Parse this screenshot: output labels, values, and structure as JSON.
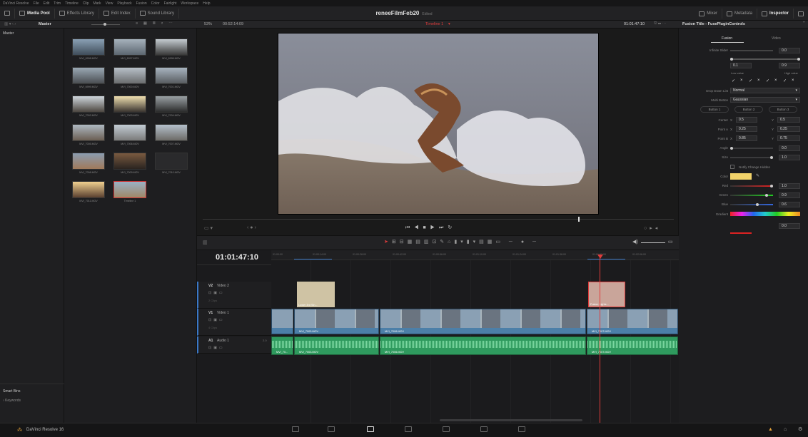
{
  "menu": [
    "DaVinci Resolve",
    "File",
    "Edit",
    "Trim",
    "Timeline",
    "Clip",
    "Mark",
    "View",
    "Playback",
    "Fusion",
    "Color",
    "Fairlight",
    "Workspace",
    "Help"
  ],
  "toolbar": {
    "media_pool": "Media Pool",
    "effects_library": "Effects Library",
    "edit_index": "Edit Index",
    "sound_library": "Sound Library",
    "mixer": "Mixer",
    "metadata": "Metadata",
    "inspector": "Inspector"
  },
  "project": {
    "title": "reneeFilmFeb20",
    "status": "Edited"
  },
  "viewerbar": {
    "bin": "Master",
    "zoom": "53%",
    "source_tc": "00:52:14:09",
    "timeline_name": "Timeline 1",
    "record_tc": "01:01:47:10"
  },
  "inspector": {
    "title": "Fusion Title - FusePluginControls",
    "tab_fusion": "Fusion",
    "tab_video": "Video"
  },
  "bins": {
    "master": "Master",
    "smart_bins": "Smart Bins",
    "keywords": "Keywords"
  },
  "clips": [
    "MVI_6998.MOV",
    "MVI_6997.MOV",
    "MVI_6996.MOV",
    "MVI_6999.MOV",
    "MVI_7000.MOV",
    "MVI_7001.MOV",
    "MVI_7002.MOV",
    "MVI_7003.MOV",
    "MVI_7004.MOV",
    "MVI_7005.MOV",
    "MVI_7006.MOV",
    "MVI_7007.MOV",
    "MVI_7008.MOV",
    "MVI_7009.MOV",
    "MVI_7010.MOV",
    "MVI_7011.MOV",
    "Timeline 1"
  ],
  "controls": {
    "infinite_slider": "Infinite Slider",
    "infinite_val": "0.0",
    "low_val": "0.1",
    "high_val": "0.9",
    "low_label": "Low value",
    "high_label": "High value",
    "drop_down": "Drop Down List",
    "drop_val": "Normal",
    "multi_button": "Multi Button",
    "multi_val": "Gaussian",
    "btn1": "Button 1",
    "btn2": "Button 2",
    "btn3": "Button 3",
    "center": "Center",
    "center_x": "0.5",
    "center_y": "0.5",
    "point_a": "Point A",
    "pa_x": "0.25",
    "pa_y": "0.25",
    "point_b": "Point B",
    "pb_x": "0.85",
    "pb_y": "0.75",
    "angle": "Angle",
    "angle_val": "0.0",
    "size": "Size",
    "size_val": "1.0",
    "notify": "Notify Change Hidden",
    "color": "Color",
    "red": "Red",
    "red_val": "1.0",
    "green": "Green",
    "green_val": "0.9",
    "blue": "Blue",
    "blue_val": "0.6",
    "gradient": "Gradient",
    "grad_val": "0.0",
    "x": "X",
    "y": "Y"
  },
  "timeline": {
    "timecode": "01:01:47:10",
    "ruler": [
      "01:00:00",
      "01:00:14:00",
      "01:00:28:00",
      "01:00:42:00",
      "01:00:56:00",
      "01:01:10:00",
      "01:01:24:00",
      "01:01:38:00",
      "01:01:52:00",
      "01:02:06:00"
    ],
    "v2": "V2",
    "v2_name": "Video 2",
    "v2_count": "2 Clips",
    "v1": "V1",
    "v1_name": "Video 1",
    "v1_count": "4 Clips",
    "a1": "A1",
    "a1_name": "Audio 1",
    "a1_ch": "2.0",
    "title_clip1": "Lower 3rd Sin...",
    "title_clip2": "Fusion Lights...",
    "v1_labels": [
      "MVI_7003.MOV",
      "MVI_7006.MOV",
      "MVI_7007.MOV"
    ],
    "a1_labels": [
      "MVI_70...",
      "MVI_7003.MOV",
      "MVI_7006.MOV",
      "MVI_7007.MOV"
    ]
  },
  "app_name": "DaVinci Resolve 16",
  "colors": {
    "accent": "#e03c3c",
    "title_clip": "#cfc3a4",
    "video_clip": "#4c7fa8",
    "audio_clip": "#2f9a5e",
    "swatch": "#f2d36a"
  }
}
